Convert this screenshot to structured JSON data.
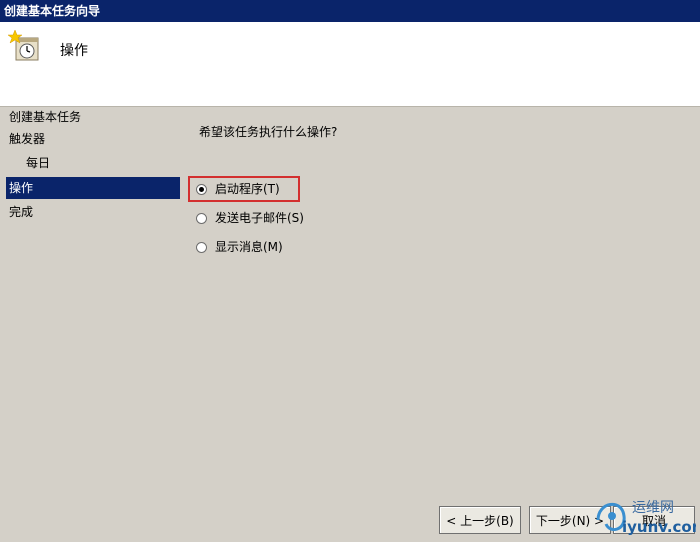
{
  "window": {
    "title": "创建基本任务向导"
  },
  "header": {
    "title": "操作",
    "icon": "scheduled-task-clock-icon"
  },
  "sidebar": {
    "items": [
      {
        "label": "创建基本任务"
      },
      {
        "label": "触发器"
      },
      {
        "label": "每日"
      },
      {
        "label": "操作",
        "selected": true
      },
      {
        "label": "完成"
      }
    ]
  },
  "main": {
    "question": "希望该任务执行什么操作?",
    "options": [
      {
        "label": "启动程序(T)",
        "checked": true
      },
      {
        "label": "发送电子邮件(S)",
        "checked": false
      },
      {
        "label": "显示消息(M)",
        "checked": false
      }
    ]
  },
  "buttons": {
    "back": "< 上一步(B)",
    "next": "下一步(N) >",
    "cancel": "取消"
  },
  "watermark": {
    "line1": "运维网",
    "line2": "iyunv.com"
  },
  "colors": {
    "titlebar": "#0a246a",
    "selection": "#0a246a",
    "highlight_border": "#d32f2f",
    "dialog_bg": "#d4d0c8"
  }
}
